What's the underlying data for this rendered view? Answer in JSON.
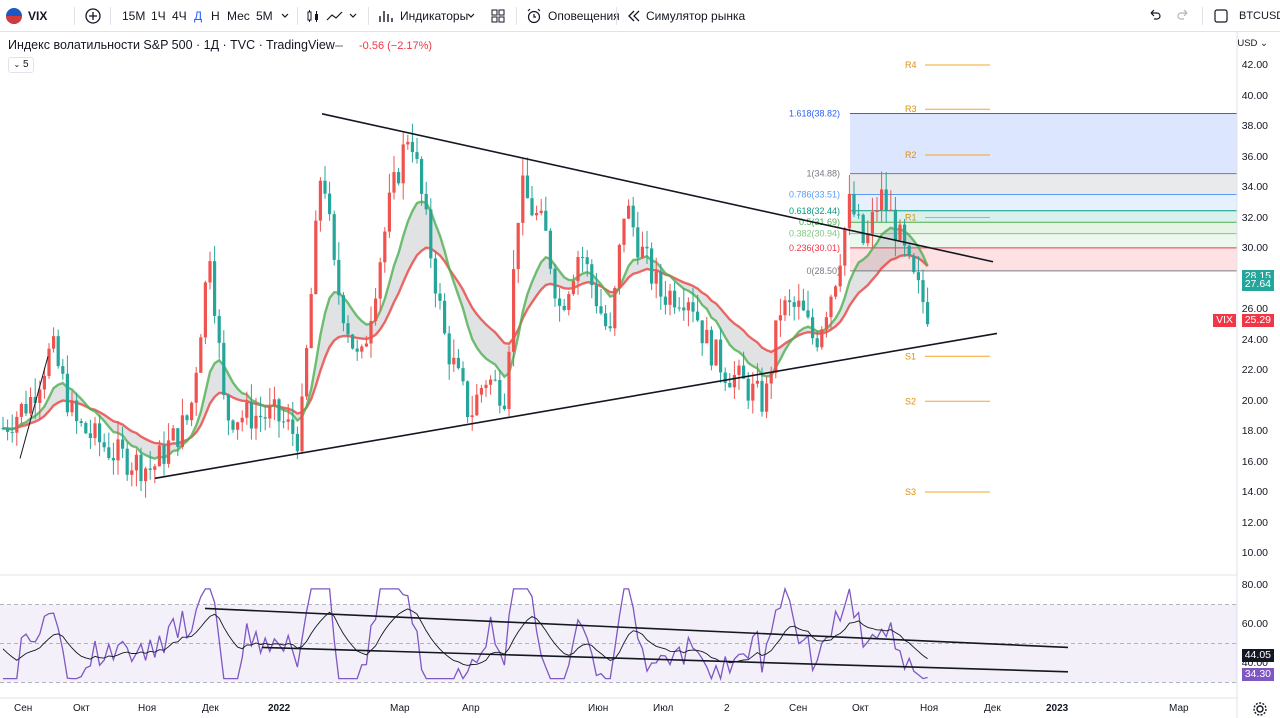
{
  "toolbar": {
    "symbol": "VIX",
    "intervals": [
      "15М",
      "1Ч",
      "4Ч",
      "Д",
      "Н",
      "Мес",
      "5М"
    ],
    "indicators_label": "Индикаторы",
    "alerts_label": "Оповещения",
    "replay_label": "Симулятор рынка",
    "right_symbol": "BTCUSD"
  },
  "legend": {
    "title": "Индекс волатильности S&P 500 · 1Д · TVC · TradingView",
    "change": "-0.56 (−2.17%)",
    "collapse_count": "5"
  },
  "price_axis": {
    "currency": "USD",
    "labels": [
      "42.00",
      "40.00",
      "38.00",
      "36.00",
      "34.00",
      "32.00",
      "30.00",
      "28.00",
      "26.00",
      "24.00",
      "22.00",
      "20.00",
      "18.00",
      "16.00",
      "14.00",
      "12.00",
      "10.00"
    ],
    "tags": [
      {
        "value": "28.15",
        "color": "#26a69a"
      },
      {
        "value": "27.64",
        "color": "#26a69a"
      },
      {
        "value": "25.29",
        "color": "#f23645",
        "symbol": "VIX"
      }
    ]
  },
  "rsi_axis": {
    "labels": [
      "80.00",
      "60.00",
      "40.00"
    ],
    "tags": [
      {
        "value": "44.05",
        "color": "#131722"
      },
      {
        "value": "34.30",
        "color": "#7e57c2"
      }
    ]
  },
  "pivots": [
    "R4",
    "R3",
    "R2",
    "R1",
    "S1",
    "S2",
    "S3"
  ],
  "fib_levels": [
    {
      "label": "1.618(38.82)",
      "color": "#2962ff"
    },
    {
      "label": "1(34.88)",
      "color": "#787b86"
    },
    {
      "label": "0.786(33.51)",
      "color": "#5b9cf6"
    },
    {
      "label": "0.618(32.44)",
      "color": "#089981"
    },
    {
      "label": "0.5(31.69)",
      "color": "#4caf50"
    },
    {
      "label": "0.382(30.94)",
      "color": "#81c784"
    },
    {
      "label": "0.236(30.01)",
      "color": "#f23645"
    },
    {
      "label": "0(28.50)",
      "color": "#787b86"
    }
  ],
  "time_axis": [
    "Сен",
    "Окт",
    "Ноя",
    "Дек",
    "2022",
    "Мар",
    "Апр",
    "Июн",
    "Июл",
    "2",
    "Сен",
    "Окт",
    "Ноя",
    "Дек",
    "2023",
    "Мар"
  ],
  "colors": {
    "up": "#26a69a",
    "down": "#ef5350",
    "rsi": "#7e57c2",
    "ema_fast": "#4caf50",
    "ema_slow": "#e53935"
  }
}
